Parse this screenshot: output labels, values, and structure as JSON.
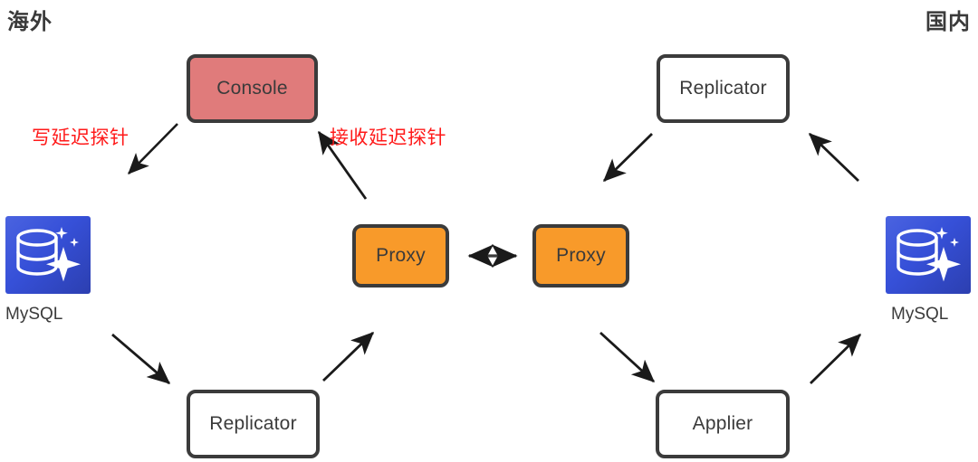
{
  "diagram": {
    "title_hidden": "",
    "regions": {
      "left_label": "海外",
      "right_label": "国内"
    },
    "colors": {
      "console_fill": "#e07b7b",
      "proxy_fill": "#f89a2a",
      "node_border": "#3b3b3b",
      "node_text": "#3b3b3b",
      "probe_text": "#ff1a1a",
      "db_icon_blue": "#3650d8",
      "background": "#ffffff"
    },
    "nodes": [
      {
        "id": "console",
        "label": "Console",
        "style": "filled-red"
      },
      {
        "id": "replicator-left",
        "label": "Replicator",
        "style": "outline"
      },
      {
        "id": "proxy-left",
        "label": "Proxy",
        "style": "filled-orange"
      },
      {
        "id": "proxy-right",
        "label": "Proxy",
        "style": "filled-orange"
      },
      {
        "id": "replicator-right",
        "label": "Replicator",
        "style": "outline"
      },
      {
        "id": "applier-right",
        "label": "Applier",
        "style": "outline"
      }
    ],
    "databases": [
      {
        "id": "mysql-left",
        "caption": "MySQL",
        "icon": "database-sparkle-icon"
      },
      {
        "id": "mysql-right",
        "caption": "MySQL",
        "icon": "database-sparkle-icon"
      }
    ],
    "edge_labels": [
      {
        "id": "write-probe",
        "text": "写延迟探针"
      },
      {
        "id": "receive-probe",
        "text": "接收延迟探针"
      }
    ],
    "edges": [
      {
        "from": "console",
        "to": "mysql-left",
        "label": "写延迟探针",
        "direction": "one-way"
      },
      {
        "from": "proxy-left",
        "to": "console",
        "label": "接收延迟探针",
        "direction": "one-way"
      },
      {
        "from": "mysql-left",
        "to": "replicator-left",
        "direction": "one-way"
      },
      {
        "from": "replicator-left",
        "to": "proxy-left",
        "direction": "one-way"
      },
      {
        "from": "proxy-left",
        "to": "proxy-right",
        "direction": "two-way"
      },
      {
        "from": "replicator-right",
        "to": "proxy-right",
        "direction": "one-way"
      },
      {
        "from": "mysql-right",
        "to": "replicator-right",
        "direction": "one-way"
      },
      {
        "from": "proxy-right",
        "to": "applier-right",
        "direction": "one-way"
      },
      {
        "from": "applier-right",
        "to": "mysql-right",
        "direction": "one-way"
      }
    ]
  }
}
